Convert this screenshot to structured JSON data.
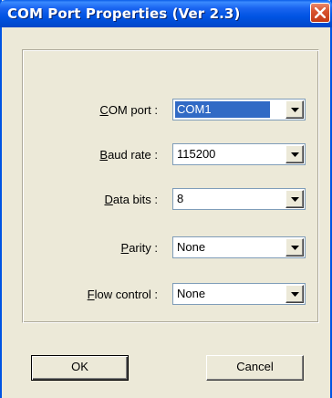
{
  "window": {
    "title": "COM Port Properties (Ver 2.3)"
  },
  "fields": [
    {
      "label_accel": "C",
      "label_rest": "OM port :",
      "value": "COM1"
    },
    {
      "label_accel": "B",
      "label_rest": "aud rate :",
      "value": "115200"
    },
    {
      "label_accel": "D",
      "label_rest": "ata bits :",
      "value": "8"
    },
    {
      "label_accel": "P",
      "label_rest": "arity :",
      "value": "None"
    },
    {
      "label_accel": "F",
      "label_rest": "low control :",
      "value": "None"
    }
  ],
  "buttons": {
    "ok_label": "OK",
    "cancel_label": "Cancel"
  },
  "colors": {
    "titlebar": "#0054e3",
    "close_button": "#d8542f",
    "dialog_face": "#ece9d8",
    "selection": "#316ac5"
  },
  "icons": {
    "close": "close-icon",
    "dropdown": "chevron-down-icon"
  }
}
